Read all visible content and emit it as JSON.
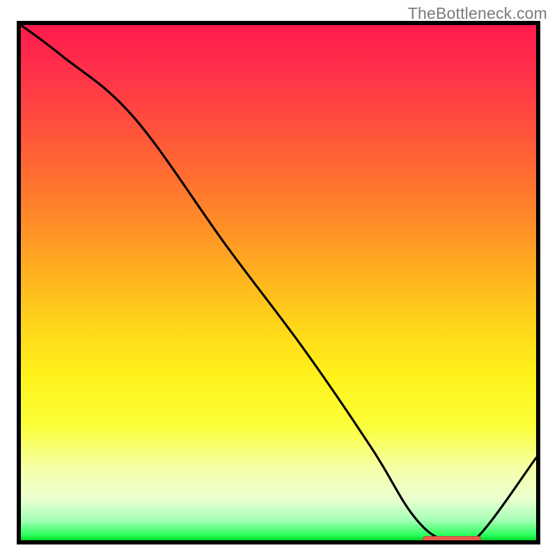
{
  "watermark": "TheBottleneck.com",
  "colors": {
    "frame": "#000000",
    "curve": "#000000",
    "marker": "#e85a4a",
    "watermark_text": "#7a7a7a"
  },
  "chart_data": {
    "type": "line",
    "title": "",
    "xlabel": "",
    "ylabel": "",
    "xlim": [
      0,
      100
    ],
    "ylim": [
      0,
      100
    ],
    "grid": false,
    "legend": false,
    "series": [
      {
        "name": "bottleneck-curve",
        "x": [
          0,
          8,
          22,
          40,
          55,
          68,
          76,
          82,
          88,
          100
        ],
        "values": [
          100,
          94,
          82,
          57,
          37,
          18,
          5,
          0,
          0,
          16
        ]
      }
    ],
    "annotations": [
      {
        "name": "optimal-range-marker",
        "type": "h-segment",
        "y": 0,
        "x_start": 78,
        "x_end": 89
      }
    ],
    "background": {
      "type": "vertical-gradient",
      "stops": [
        {
          "pct": 0,
          "color": "#ff1a4d"
        },
        {
          "pct": 50,
          "color": "#ffc21a"
        },
        {
          "pct": 85,
          "color": "#f8ff70"
        },
        {
          "pct": 100,
          "color": "#00d724"
        }
      ]
    }
  }
}
